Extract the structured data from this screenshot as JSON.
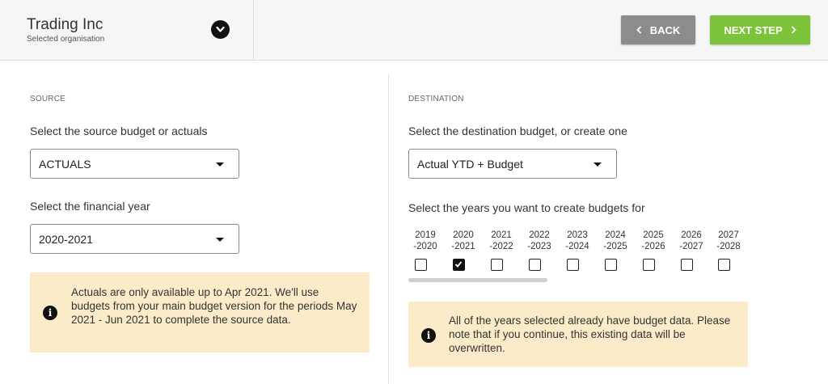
{
  "header": {
    "org_name": "Trading Inc",
    "org_subtitle": "Selected organisation",
    "back_label": "BACK",
    "next_label": "NEXT STEP"
  },
  "source": {
    "section_title": "SOURCE",
    "budget_label": "Select the source budget or actuals",
    "budget_value": "ACTUALS",
    "year_label": "Select the financial year",
    "year_value": "2020-2021",
    "notice": "Actuals are only available up to Apr 2021. We'll use budgets from your main budget version for the periods May 2021 - Jun 2021 to complete the source data."
  },
  "destination": {
    "section_title": "DESTINATION",
    "budget_label": "Select the destination budget, or create one",
    "budget_value": "Actual YTD + Budget",
    "years_label": "Select the years you want to create budgets for",
    "years": [
      {
        "line1": "2019",
        "line2": "-2020",
        "checked": false
      },
      {
        "line1": "2020",
        "line2": "-2021",
        "checked": true
      },
      {
        "line1": "2021",
        "line2": "-2022",
        "checked": false
      },
      {
        "line1": "2022",
        "line2": "-2023",
        "checked": false
      },
      {
        "line1": "2023",
        "line2": "-2024",
        "checked": false
      },
      {
        "line1": "2024",
        "line2": "-2025",
        "checked": false
      },
      {
        "line1": "2025",
        "line2": "-2026",
        "checked": false
      },
      {
        "line1": "2026",
        "line2": "-2027",
        "checked": false
      },
      {
        "line1": "2027",
        "line2": "-2028",
        "checked": false
      }
    ],
    "notice": "All of the years selected already have budget data. Please note that if you continue, this existing data will be overwritten."
  },
  "colors": {
    "next_button": "#7cc33b",
    "back_button": "#8c8c8c",
    "notice_background": "#fcebc9"
  },
  "icons": {
    "org_toggle": "chevron-down-icon",
    "back": "chevron-left-icon",
    "next": "chevron-right-icon",
    "notice": "info-icon"
  }
}
